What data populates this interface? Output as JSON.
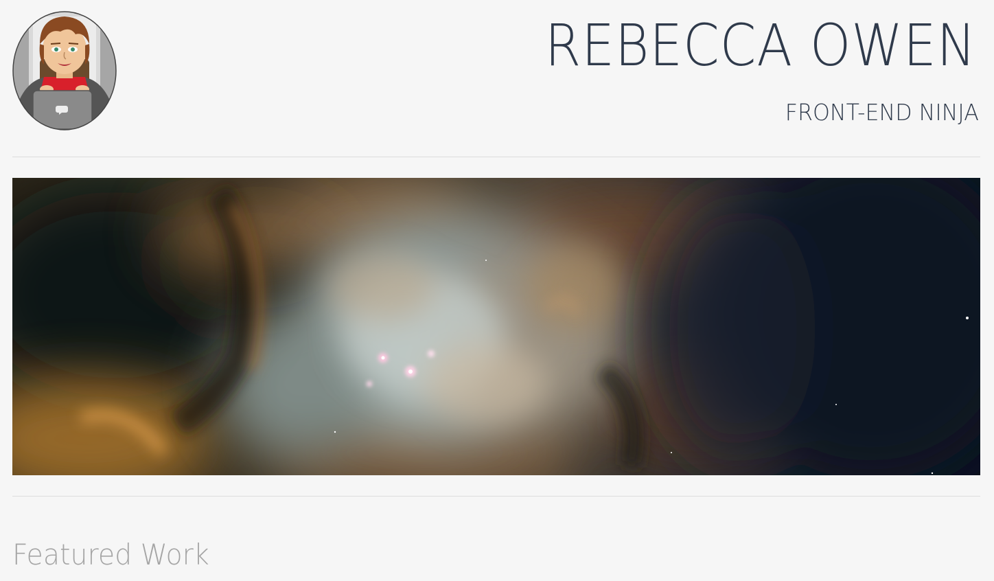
{
  "header": {
    "name": "REBECCA OWEN",
    "tagline": "FRONT-END NINJA",
    "avatar_icon": "cartoon-avatar-icon"
  },
  "hero": {
    "image_subject": "nebula"
  },
  "featured": {
    "title": "Featured Work"
  },
  "colors": {
    "background": "#f6f6f6",
    "heading_text": "#2f3a4b",
    "section_title": "#a5a5a5",
    "divider": "#dcdcdc"
  }
}
